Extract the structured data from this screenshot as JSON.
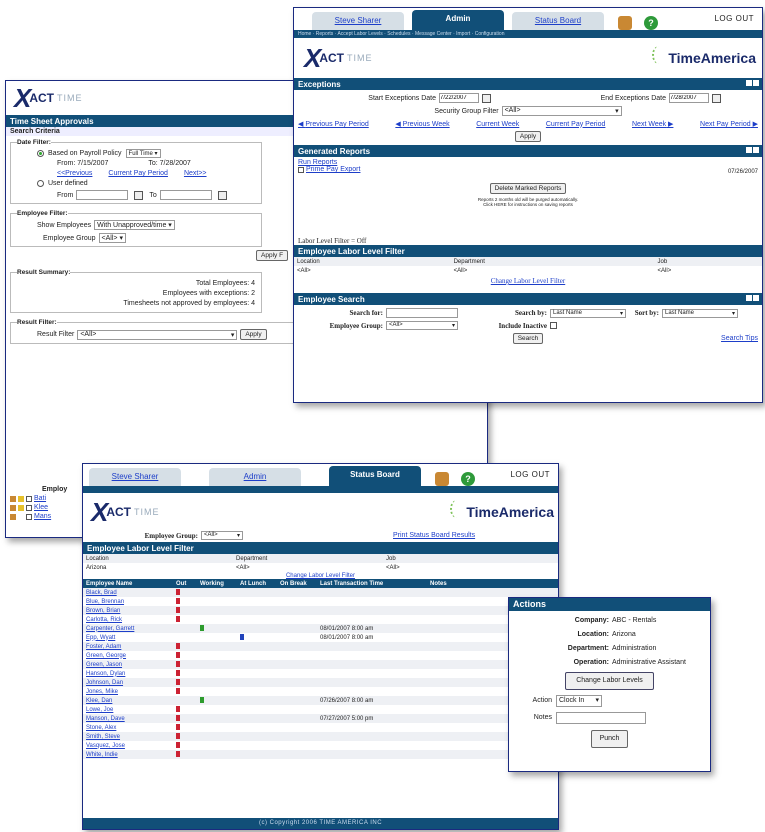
{
  "ts": {
    "title": "Time Sheet Approvals",
    "criteria": "Search Criteria",
    "date_filter": "Date Filter:",
    "payroll_label": "Based on Payroll Policy",
    "payroll_value": "Full Time",
    "from": "From: 7/15/2007",
    "to": "To: 7/28/2007",
    "prev": "<<Previous",
    "current": "Current Pay Period",
    "next": "Next>>",
    "user_defined": "User defined",
    "from_label": "From",
    "to_label": "To",
    "emp_filter": "Employee Filter:",
    "show_label": "Show Employees",
    "show_value": "With Unapproved/time",
    "group_label": "Employee Group",
    "group_value": "<All>",
    "apply": "Apply F",
    "result_summary": "Result Summary:",
    "total": "Total Employees: 4",
    "exceptions": "Employees with exceptions: 2",
    "not_approved": "Timesheets not approved by employees: 4",
    "result_filter": "Result Filter:",
    "result_label": "Result Filter",
    "result_value": "<All>",
    "apply2": "Apply",
    "emp_head": "Employ",
    "rows": [
      "Bati",
      "Klee",
      "Mans"
    ]
  },
  "admin": {
    "tabs": [
      "Steve Sharer",
      "Admin",
      "Status Board"
    ],
    "logout": "LOG OUT",
    "subnav": "Home · Reports · Accept Labor Levels · Schedules · Message Center · Import · Configuration",
    "brand": "TimeAmerica",
    "exceptions": "Exceptions",
    "start_label": "Start Exceptions Date",
    "start_value": "7/22/2007",
    "end_label": "End Exceptions Date",
    "end_value": "7/28/2007",
    "sec_label": "Security Group Filter",
    "sec_value": "<All>",
    "nav": [
      "Previous Pay Period",
      "Previous Week",
      "Current Week",
      "Current Pay Period",
      "Next Week",
      "Next Pay Period"
    ],
    "apply": "Apply",
    "generated": "Generated Reports",
    "run_reports": "Run Reports",
    "prime_pay": "Prime Pay Export",
    "report_date": "07/26/2007",
    "delete": "Delete Marked Reports",
    "note1": "Reports 2 months old will be purged automatically.",
    "note2": "Click HERE for instructions on saving reports",
    "labor_filter": "Labor Level Filter = Off",
    "elf": "Employee Labor Level Filter",
    "cols": [
      "Location",
      "Department",
      "Job"
    ],
    "vals": [
      "<All>",
      "<All>",
      "<All>"
    ],
    "change": "Change Labor Level Filter",
    "search": "Employee Search",
    "search_for": "Search for:",
    "search_by": "Search by:",
    "search_by_value": "Last Name",
    "sort_by": "Sort by:",
    "sort_by_value": "Last Name",
    "emp_group": "Employee Group:",
    "emp_group_value": "<All>",
    "include_inactive": "Include Inactive",
    "search_btn": "Search",
    "search_tips": "Search Tips"
  },
  "status": {
    "tabs": [
      "Steve Sharer",
      "Admin",
      "Status Board"
    ],
    "logout": "LOG OUT",
    "brand": "TimeAmerica",
    "group_label": "Employee Group:",
    "group_value": "<All>",
    "print": "Print Status Board Results",
    "elf": "Employee Labor Level Filter",
    "cols": [
      "Location",
      "Department",
      "Job"
    ],
    "vals": [
      "Arizona",
      "<All>",
      "<All>"
    ],
    "change": "Change Labor Level Filter",
    "headers": [
      "Employee Name",
      "Out",
      "Working",
      "At Lunch",
      "On Break",
      "Last Transaction Time",
      "Notes"
    ],
    "employees": [
      {
        "name": "Black, Brad",
        "state": "out",
        "time": ""
      },
      {
        "name": "Blue, Brennan",
        "state": "out",
        "time": ""
      },
      {
        "name": "Brown, Brian",
        "state": "out",
        "time": ""
      },
      {
        "name": "Carlotta, Rick",
        "state": "out",
        "time": ""
      },
      {
        "name": "Carpenter, Garrett",
        "state": "working",
        "time": "08/01/2007 8:00 am"
      },
      {
        "name": "Epp, Wyatt",
        "state": "lunch",
        "time": "08/01/2007 8:00 am"
      },
      {
        "name": "Foster, Adam",
        "state": "out",
        "time": ""
      },
      {
        "name": "Green, George",
        "state": "out",
        "time": ""
      },
      {
        "name": "Green, Jason",
        "state": "out",
        "time": ""
      },
      {
        "name": "Hanson, Dylan",
        "state": "out",
        "time": ""
      },
      {
        "name": "Johnson, Dan",
        "state": "out",
        "time": ""
      },
      {
        "name": "Jones, Mike",
        "state": "out",
        "time": ""
      },
      {
        "name": "Klee, Dan",
        "state": "working",
        "time": "07/26/2007 8:00 am"
      },
      {
        "name": "Lowe, Joe",
        "state": "out",
        "time": ""
      },
      {
        "name": "Manson, Dave",
        "state": "out",
        "time": "07/27/2007 5:00 pm"
      },
      {
        "name": "Stone, Alex",
        "state": "out",
        "time": ""
      },
      {
        "name": "Smith, Steve",
        "state": "out",
        "time": ""
      },
      {
        "name": "Vasquez, Jose",
        "state": "out",
        "time": ""
      },
      {
        "name": "White, Indie",
        "state": "out",
        "time": ""
      }
    ],
    "footer": "(c) Copyright 2006 TIME AMERICA INC"
  },
  "actions": {
    "title": "Actions",
    "company_label": "Company:",
    "company": "ABC - Rentals",
    "location_label": "Location:",
    "location": "Arizona",
    "department_label": "Department:",
    "department": "Administration",
    "operation_label": "Operation:",
    "operation": "Administrative Assistant",
    "change_btn": "Change Labor Levels",
    "action_label": "Action",
    "action_value": "Clock In",
    "notes_label": "Notes",
    "punch": "Punch"
  }
}
